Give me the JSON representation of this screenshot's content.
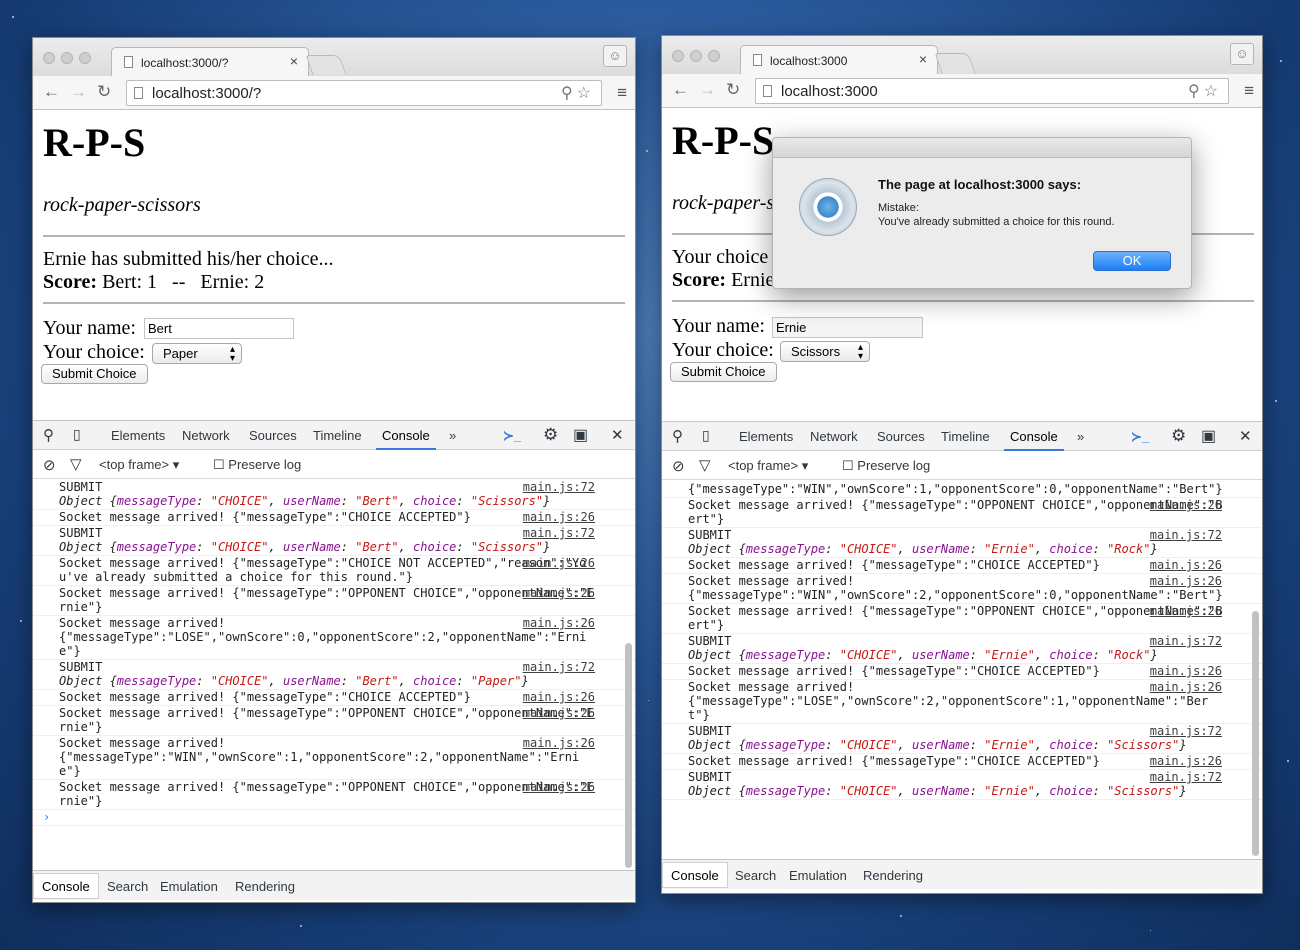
{
  "left": {
    "tab_title": "localhost:3000/?",
    "url": "localhost:3000/?",
    "page": {
      "heading": "R-P-S",
      "subheading": "rock-paper-scissors",
      "status": "Ernie has submitted his/her choice...",
      "score_label": "Score:",
      "score_text": " Bert: 1   --   Ernie: 2",
      "name_label": "Your name:",
      "name_value": "Bert",
      "choice_label": "Your choice:",
      "choice_value": "Paper",
      "submit_label": "Submit Choice"
    },
    "console": [
      {
        "type": "obj",
        "src": "main.js:72",
        "text": "SUBMIT",
        "obj": {
          "messageType": "CHOICE",
          "userName": "Bert",
          "choice": "Scissors"
        }
      },
      {
        "type": "text",
        "src": "main.js:26",
        "text": "Socket message arrived! {\"messageType\":\"CHOICE ACCEPTED\"}"
      },
      {
        "type": "obj",
        "src": "main.js:72",
        "text": "SUBMIT",
        "obj": {
          "messageType": "CHOICE",
          "userName": "Bert",
          "choice": "Scissors"
        }
      },
      {
        "type": "text",
        "src": "main.js:26",
        "text": "Socket message arrived! {\"messageType\":\"CHOICE NOT ACCEPTED\",\"reason\":\"You've already submitted a choice for this round.\"}"
      },
      {
        "type": "text",
        "src": "main.js:26",
        "text": "Socket message arrived! {\"messageType\":\"OPPONENT CHOICE\",\"opponentName\":\"Ernie\"}"
      },
      {
        "type": "text",
        "src": "main.js:26",
        "text": "Socket message arrived!\n{\"messageType\":\"LOSE\",\"ownScore\":0,\"opponentScore\":2,\"opponentName\":\"Ernie\"}"
      },
      {
        "type": "obj",
        "src": "main.js:72",
        "text": "SUBMIT",
        "obj": {
          "messageType": "CHOICE",
          "userName": "Bert",
          "choice": "Paper"
        }
      },
      {
        "type": "text",
        "src": "main.js:26",
        "text": "Socket message arrived! {\"messageType\":\"CHOICE ACCEPTED\"}"
      },
      {
        "type": "text",
        "src": "main.js:26",
        "text": "Socket message arrived! {\"messageType\":\"OPPONENT CHOICE\",\"opponentName\":\"Ernie\"}"
      },
      {
        "type": "text",
        "src": "main.js:26",
        "text": "Socket message arrived!\n{\"messageType\":\"WIN\",\"ownScore\":1,\"opponentScore\":2,\"opponentName\":\"Ernie\"}"
      },
      {
        "type": "text",
        "src": "main.js:26",
        "text": "Socket message arrived! {\"messageType\":\"OPPONENT CHOICE\",\"opponentName\":\"Ernie\"}"
      }
    ],
    "prompt": "›"
  },
  "right": {
    "tab_title": "localhost:3000",
    "url": "localhost:3000",
    "page": {
      "heading": "R-P-S",
      "subheading": "rock-paper-scissors",
      "status": "Your choice",
      "score_label": "Score:",
      "score_text": " Ernie",
      "name_label": "Your name:",
      "name_value": "Ernie",
      "choice_label": "Your choice:",
      "choice_value": "Scissors",
      "submit_label": "Submit Choice"
    },
    "console": [
      {
        "type": "text",
        "src": "",
        "text": "{\"messageType\":\"WIN\",\"ownScore\":1,\"opponentScore\":0,\"opponentName\":\"Bert\"}"
      },
      {
        "type": "text",
        "src": "main.js:26",
        "text": "Socket message arrived! {\"messageType\":\"OPPONENT CHOICE\",\"opponentName\":\"Bert\"}"
      },
      {
        "type": "obj",
        "src": "main.js:72",
        "text": "SUBMIT",
        "obj": {
          "messageType": "CHOICE",
          "userName": "Ernie",
          "choice": "Rock"
        }
      },
      {
        "type": "text",
        "src": "main.js:26",
        "text": "Socket message arrived! {\"messageType\":\"CHOICE ACCEPTED\"}"
      },
      {
        "type": "text",
        "src": "main.js:26",
        "text": "Socket message arrived!\n{\"messageType\":\"WIN\",\"ownScore\":2,\"opponentScore\":0,\"opponentName\":\"Bert\"}"
      },
      {
        "type": "text",
        "src": "main.js:26",
        "text": "Socket message arrived! {\"messageType\":\"OPPONENT CHOICE\",\"opponentName\":\"Bert\"}"
      },
      {
        "type": "obj",
        "src": "main.js:72",
        "text": "SUBMIT",
        "obj": {
          "messageType": "CHOICE",
          "userName": "Ernie",
          "choice": "Rock"
        }
      },
      {
        "type": "text",
        "src": "main.js:26",
        "text": "Socket message arrived! {\"messageType\":\"CHOICE ACCEPTED\"}"
      },
      {
        "type": "text",
        "src": "main.js:26",
        "text": "Socket message arrived!\n{\"messageType\":\"LOSE\",\"ownScore\":2,\"opponentScore\":1,\"opponentName\":\"Bert\"}"
      },
      {
        "type": "obj",
        "src": "main.js:72",
        "text": "SUBMIT",
        "obj": {
          "messageType": "CHOICE",
          "userName": "Ernie",
          "choice": "Scissors"
        }
      },
      {
        "type": "text",
        "src": "main.js:26",
        "text": "Socket message arrived! {\"messageType\":\"CHOICE ACCEPTED\"}"
      },
      {
        "type": "obj",
        "src": "main.js:72",
        "text": "SUBMIT",
        "obj": {
          "messageType": "CHOICE",
          "userName": "Ernie",
          "choice": "Scissors"
        }
      }
    ]
  },
  "devtools": {
    "tabs": [
      "Elements",
      "Network",
      "Sources",
      "Timeline",
      "Console"
    ],
    "more": "»",
    "frame": "<top frame>",
    "preserve_log": "Preserve log",
    "drawer_tabs": [
      "Console",
      "Search",
      "Emulation",
      "Rendering"
    ]
  },
  "dialog": {
    "title": "The page at localhost:3000 says:",
    "message": "Mistake:\nYou've already submitted a choice for this round.",
    "ok": "OK"
  },
  "icons": {
    "back": "←",
    "forward": "→",
    "reload": "↻",
    "zoom": "⚲",
    "star": "☆",
    "menu": "≡",
    "inspect": "⚲",
    "device": "▯",
    "terminal": "≻_",
    "settings": "⚙",
    "dock": "▣",
    "close": "✕",
    "clear": "⊘",
    "filter": "▽",
    "dropdown": "▾",
    "tab_close": "×"
  },
  "colors": {
    "accent": "#3879d9",
    "key": "#881391",
    "string": "#c41a16",
    "ok_button": "#1c7ff7"
  }
}
